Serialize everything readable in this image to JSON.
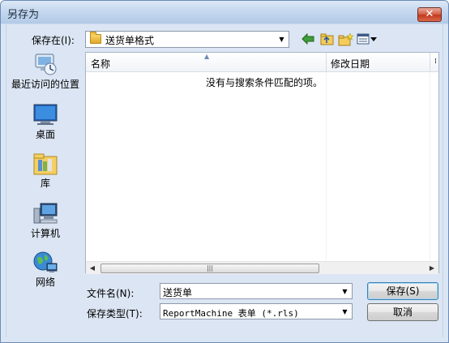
{
  "window": {
    "title": "另存为",
    "close_glyph": "✕"
  },
  "toolbar": {
    "save_in_label": "保存在(I):",
    "save_in_value": "送货单格式",
    "back_icon": "back-arrow-icon",
    "up_icon": "up-folder-icon",
    "new_folder_icon": "new-folder-icon",
    "views_icon": "views-menu-icon"
  },
  "places": [
    {
      "label": "最近访问的位置",
      "icon": "recent-places-icon"
    },
    {
      "label": "桌面",
      "icon": "desktop-icon"
    },
    {
      "label": "库",
      "icon": "libraries-icon"
    },
    {
      "label": "计算机",
      "icon": "computer-icon"
    },
    {
      "label": "网络",
      "icon": "network-icon"
    }
  ],
  "filelist": {
    "columns": [
      "名称",
      "修改日期"
    ],
    "empty_message": "没有与搜索条件匹配的项。"
  },
  "form": {
    "filename_label": "文件名(N):",
    "filename_value": "送货单",
    "filetype_label": "保存类型(T):",
    "filetype_value": "ReportMachine 表单 (*.rls)",
    "save_button": "保存(S)",
    "cancel_button": "取消"
  },
  "colors": {
    "titlebar": "#c3d6ee",
    "dialog_bg": "#dbe5f3",
    "close_red": "#c43a1c",
    "default_button_border": "#3c7fb1"
  }
}
